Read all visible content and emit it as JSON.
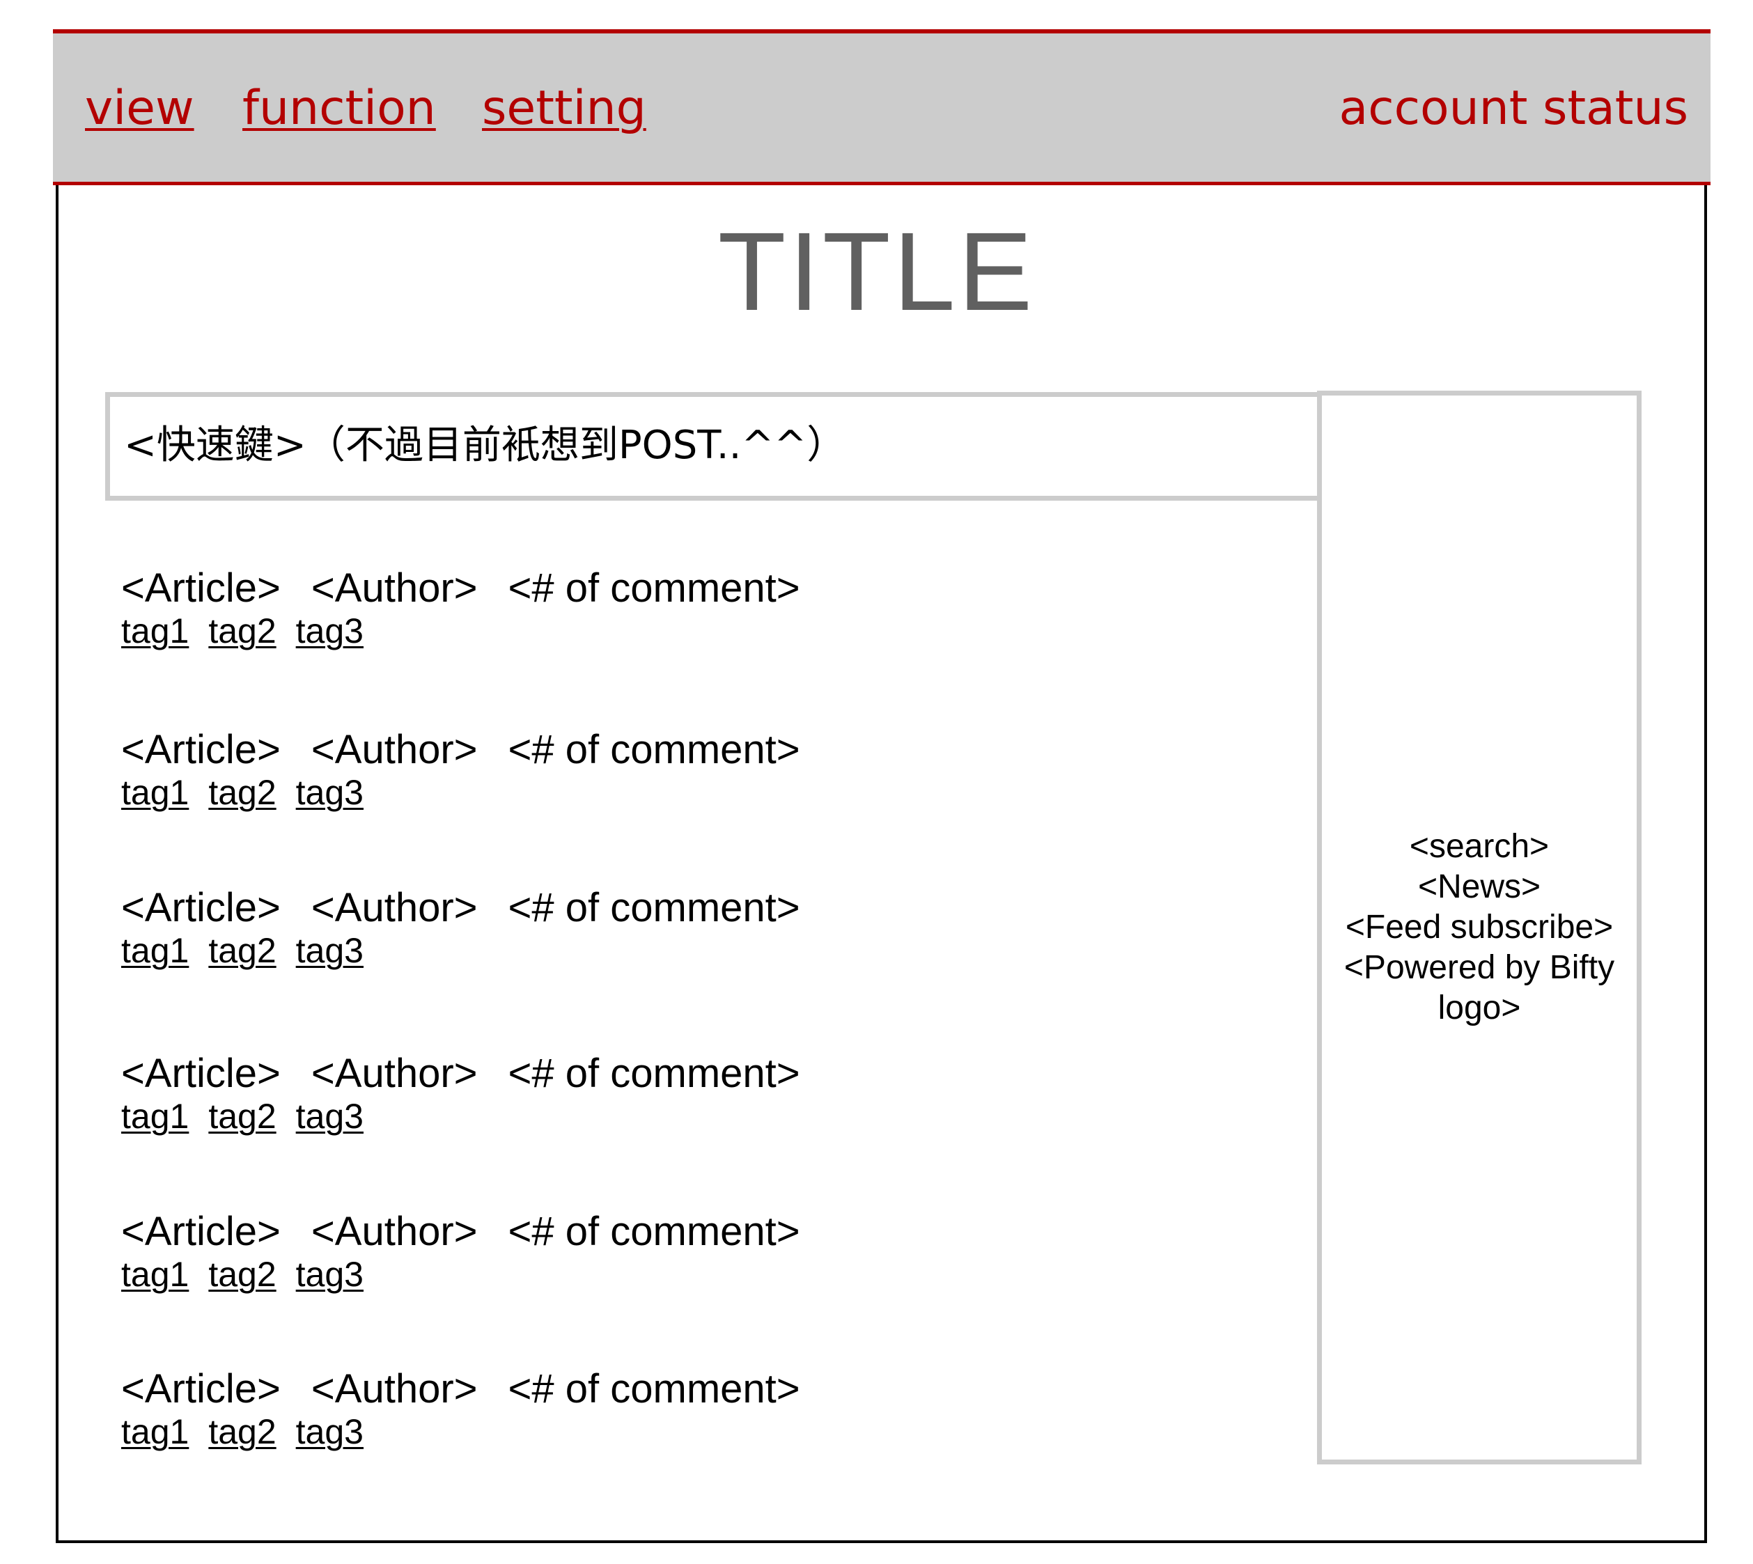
{
  "nav": {
    "items": [
      {
        "label": "view"
      },
      {
        "label": "function"
      },
      {
        "label": "setting"
      }
    ],
    "account_status": "account status"
  },
  "page": {
    "title": "TITLE"
  },
  "shortcut": {
    "label": "<快速鍵>（不過目前衹想到POST..^^）"
  },
  "sidebar": {
    "entries": [
      "<search>",
      "<News>",
      "<Feed subscribe>",
      "<Powered by Bifty",
      "logo>"
    ]
  },
  "articles": [
    {
      "article": "<Article>",
      "author": "<Author>",
      "comments": "<# of comment>",
      "tags": [
        "tag1",
        "tag2",
        "tag3"
      ]
    },
    {
      "article": "<Article>",
      "author": "<Author>",
      "comments": "<# of comment>",
      "tags": [
        "tag1",
        "tag2",
        "tag3"
      ]
    },
    {
      "article": "<Article>",
      "author": "<Author>",
      "comments": "<# of comment>",
      "tags": [
        "tag1",
        "tag2",
        "tag3"
      ]
    },
    {
      "article": "<Article>",
      "author": "<Author>",
      "comments": "<# of comment>",
      "tags": [
        "tag1",
        "tag2",
        "tag3"
      ]
    },
    {
      "article": "<Article>",
      "author": "<Author>",
      "comments": "<# of comment>",
      "tags": [
        "tag1",
        "tag2",
        "tag3"
      ]
    },
    {
      "article": "<Article>",
      "author": "<Author>",
      "comments": "<# of comment>",
      "tags": [
        "tag1",
        "tag2",
        "tag3"
      ]
    }
  ],
  "colors": {
    "accent": "#b30000",
    "navbar_bg": "#cccccc",
    "box_border": "#cccccc",
    "title_text": "#606060"
  }
}
